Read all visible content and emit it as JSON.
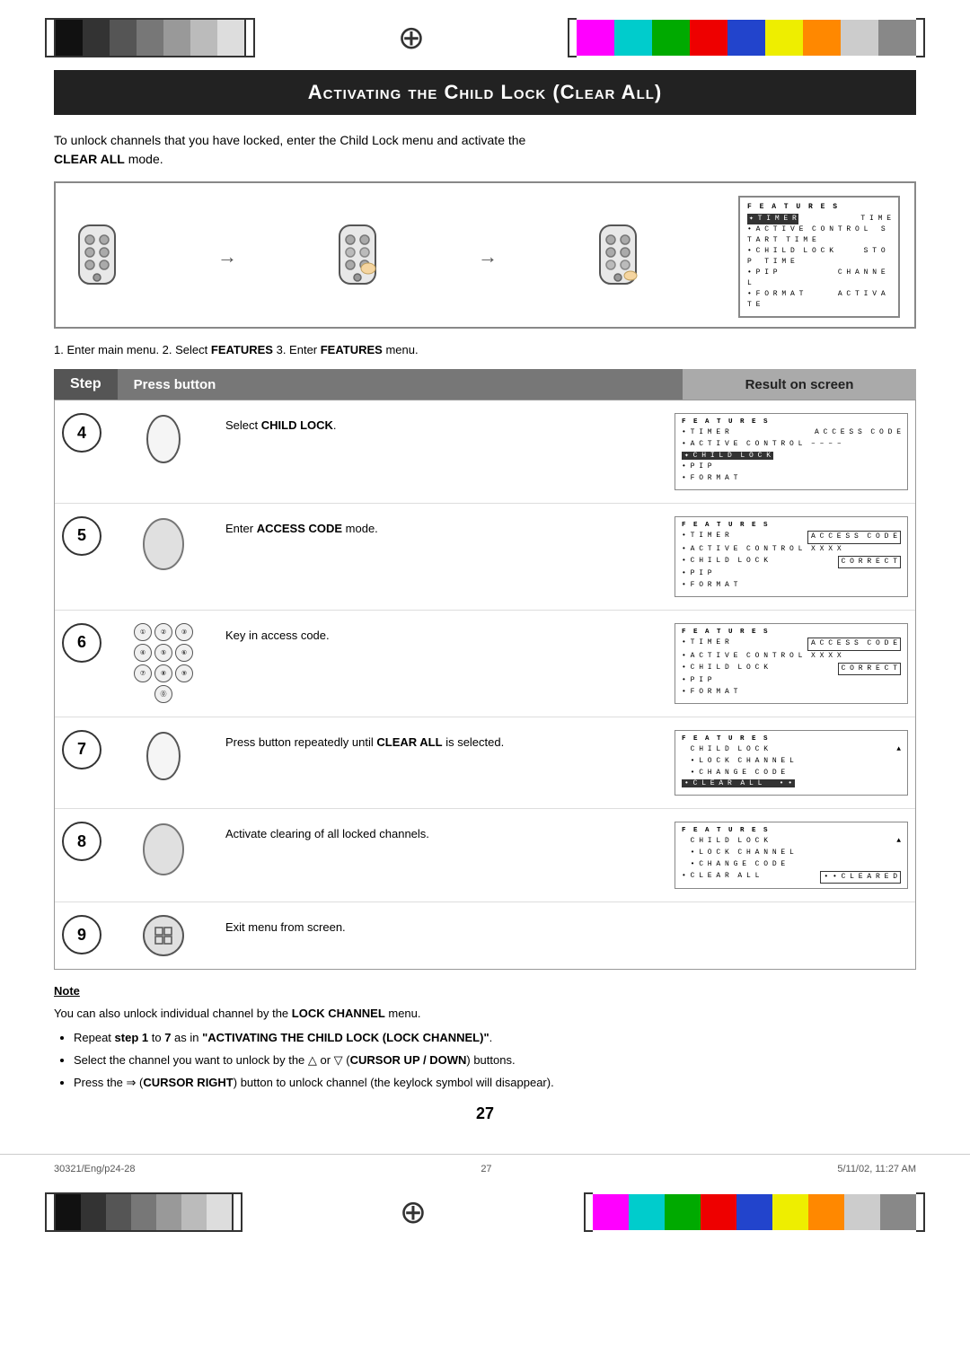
{
  "header": {
    "title": "Activating the Child Lock (Clear All)"
  },
  "intro": {
    "line1": "To unlock channels that you have locked, enter the Child Lock menu and activate the",
    "bold": "CLEAR ALL",
    "line2": "mode."
  },
  "instruction_steps": {
    "text": "1. Enter main menu.  2. Select ",
    "bold1": "FEATURES",
    "text2": "  3. Enter ",
    "bold2": "FEATURES",
    "text3": " menu."
  },
  "menu_screen_top": {
    "title": "FEATURES",
    "items": [
      {
        "label": "TIMER",
        "right": "TIME",
        "highlighted": true
      },
      {
        "label": "ACTIVE CONTROL",
        "right": "START TIME"
      },
      {
        "label": "CHILD LOCK",
        "right": "STOP TIME"
      },
      {
        "label": "PIP",
        "right": "CHANNEL"
      },
      {
        "label": "FORMAT",
        "right": "ACTIVATE"
      }
    ]
  },
  "headers": {
    "step": "Step",
    "press": "Press button",
    "result": "Result on screen"
  },
  "steps": [
    {
      "num": "4",
      "description": "Select ",
      "bold": "CHILD LOCK",
      "description2": ".",
      "result_title": "FEATURES",
      "result_items": [
        {
          "text": "• TIMER",
          "right": "ACCESS CODE"
        },
        {
          "text": "• ACTIVE CONTROL – – – –"
        },
        {
          "text": "✦ CHILD LOCK",
          "highlighted": true
        },
        {
          "text": "• PIP"
        },
        {
          "text": "• FORMAT"
        }
      ]
    },
    {
      "num": "5",
      "description": "Enter ",
      "bold": "ACCESS CODE",
      "description2": " mode.",
      "result_title": "FEATURES",
      "result_items": [
        {
          "text": "• TIMER",
          "right": "ACCESS CODE",
          "right_box": true
        },
        {
          "text": "• ACTIVE CONTROL X X X X"
        },
        {
          "text": "• CHILD LOCK",
          "right": "CORRECT",
          "right_box": true
        },
        {
          "text": "• PIP"
        },
        {
          "text": "• FORMAT"
        }
      ]
    },
    {
      "num": "6",
      "description": "Key in access code.",
      "result_title": "FEATURES",
      "result_items": [
        {
          "text": "• TIMER",
          "right": "ACCESS CODE",
          "right_box": true
        },
        {
          "text": "• ACTIVE CONTROL X X X X"
        },
        {
          "text": "• CHILD LOCK",
          "right": "CORRECT",
          "right_box": true
        },
        {
          "text": "• PIP"
        },
        {
          "text": "• FORMAT"
        }
      ]
    },
    {
      "num": "7",
      "description": "Press button repeatedly until ",
      "bold": "CLEAR ALL",
      "description2": " is selected.",
      "result_title": "FEATURES",
      "result_items": [
        {
          "text": "  CHILD LOCK",
          "right": "▲"
        },
        {
          "text": "  • LOCK CHANNEL"
        },
        {
          "text": "  • CHANGE CODE"
        },
        {
          "text": "  • CLEAR ALL",
          "right": "• •",
          "highlighted": true
        }
      ]
    },
    {
      "num": "8",
      "description": "Activate clearing of all locked channels.",
      "result_title": "FEATURES",
      "result_items": [
        {
          "text": "  CHILD LOCK",
          "right": "▲"
        },
        {
          "text": "  • LOCK CHANNEL"
        },
        {
          "text": "  • CHANGE CODE"
        },
        {
          "text": "  • CLEAR ALL",
          "right": "••CLEARED",
          "right_box": true
        }
      ]
    },
    {
      "num": "9",
      "description": "Exit menu from screen.",
      "result_items": []
    }
  ],
  "note": {
    "title": "Note",
    "line1": "You can also unlock individual channel by the ",
    "bold1": "LOCK CHANNEL",
    "line1end": " menu.",
    "bullets": [
      {
        "text": "Repeat step 1 to 7 as in ",
        "bold": "\"ACTIVATING THE CHILD LOCK (LOCK CHANNEL)\"",
        "end": "."
      },
      {
        "text": "Select the channel you want to unlock by the  ↑  or  ↓  (",
        "bold": "CURSOR UP / DOWN",
        "end": ") buttons."
      },
      {
        "text": "Press the  ⇒  (",
        "bold": "CURSOR RIGHT",
        "end": ") button to unlock channel (the keylock symbol will disappear)."
      }
    ]
  },
  "page_number": "27",
  "footer": {
    "left": "30321/Eng/p24-28",
    "center": "27",
    "right": "5/11/02, 11:27 AM"
  },
  "colors": {
    "left_bar": [
      "#111",
      "#333",
      "#555",
      "#777",
      "#999",
      "#aaa",
      "#bbb"
    ],
    "right_bar": [
      "#ff00ff",
      "#00ffff",
      "#00cc00",
      "#ff0000",
      "#0000ff",
      "#ffff00",
      "#ff8800",
      "#cccccc",
      "#999999"
    ]
  }
}
